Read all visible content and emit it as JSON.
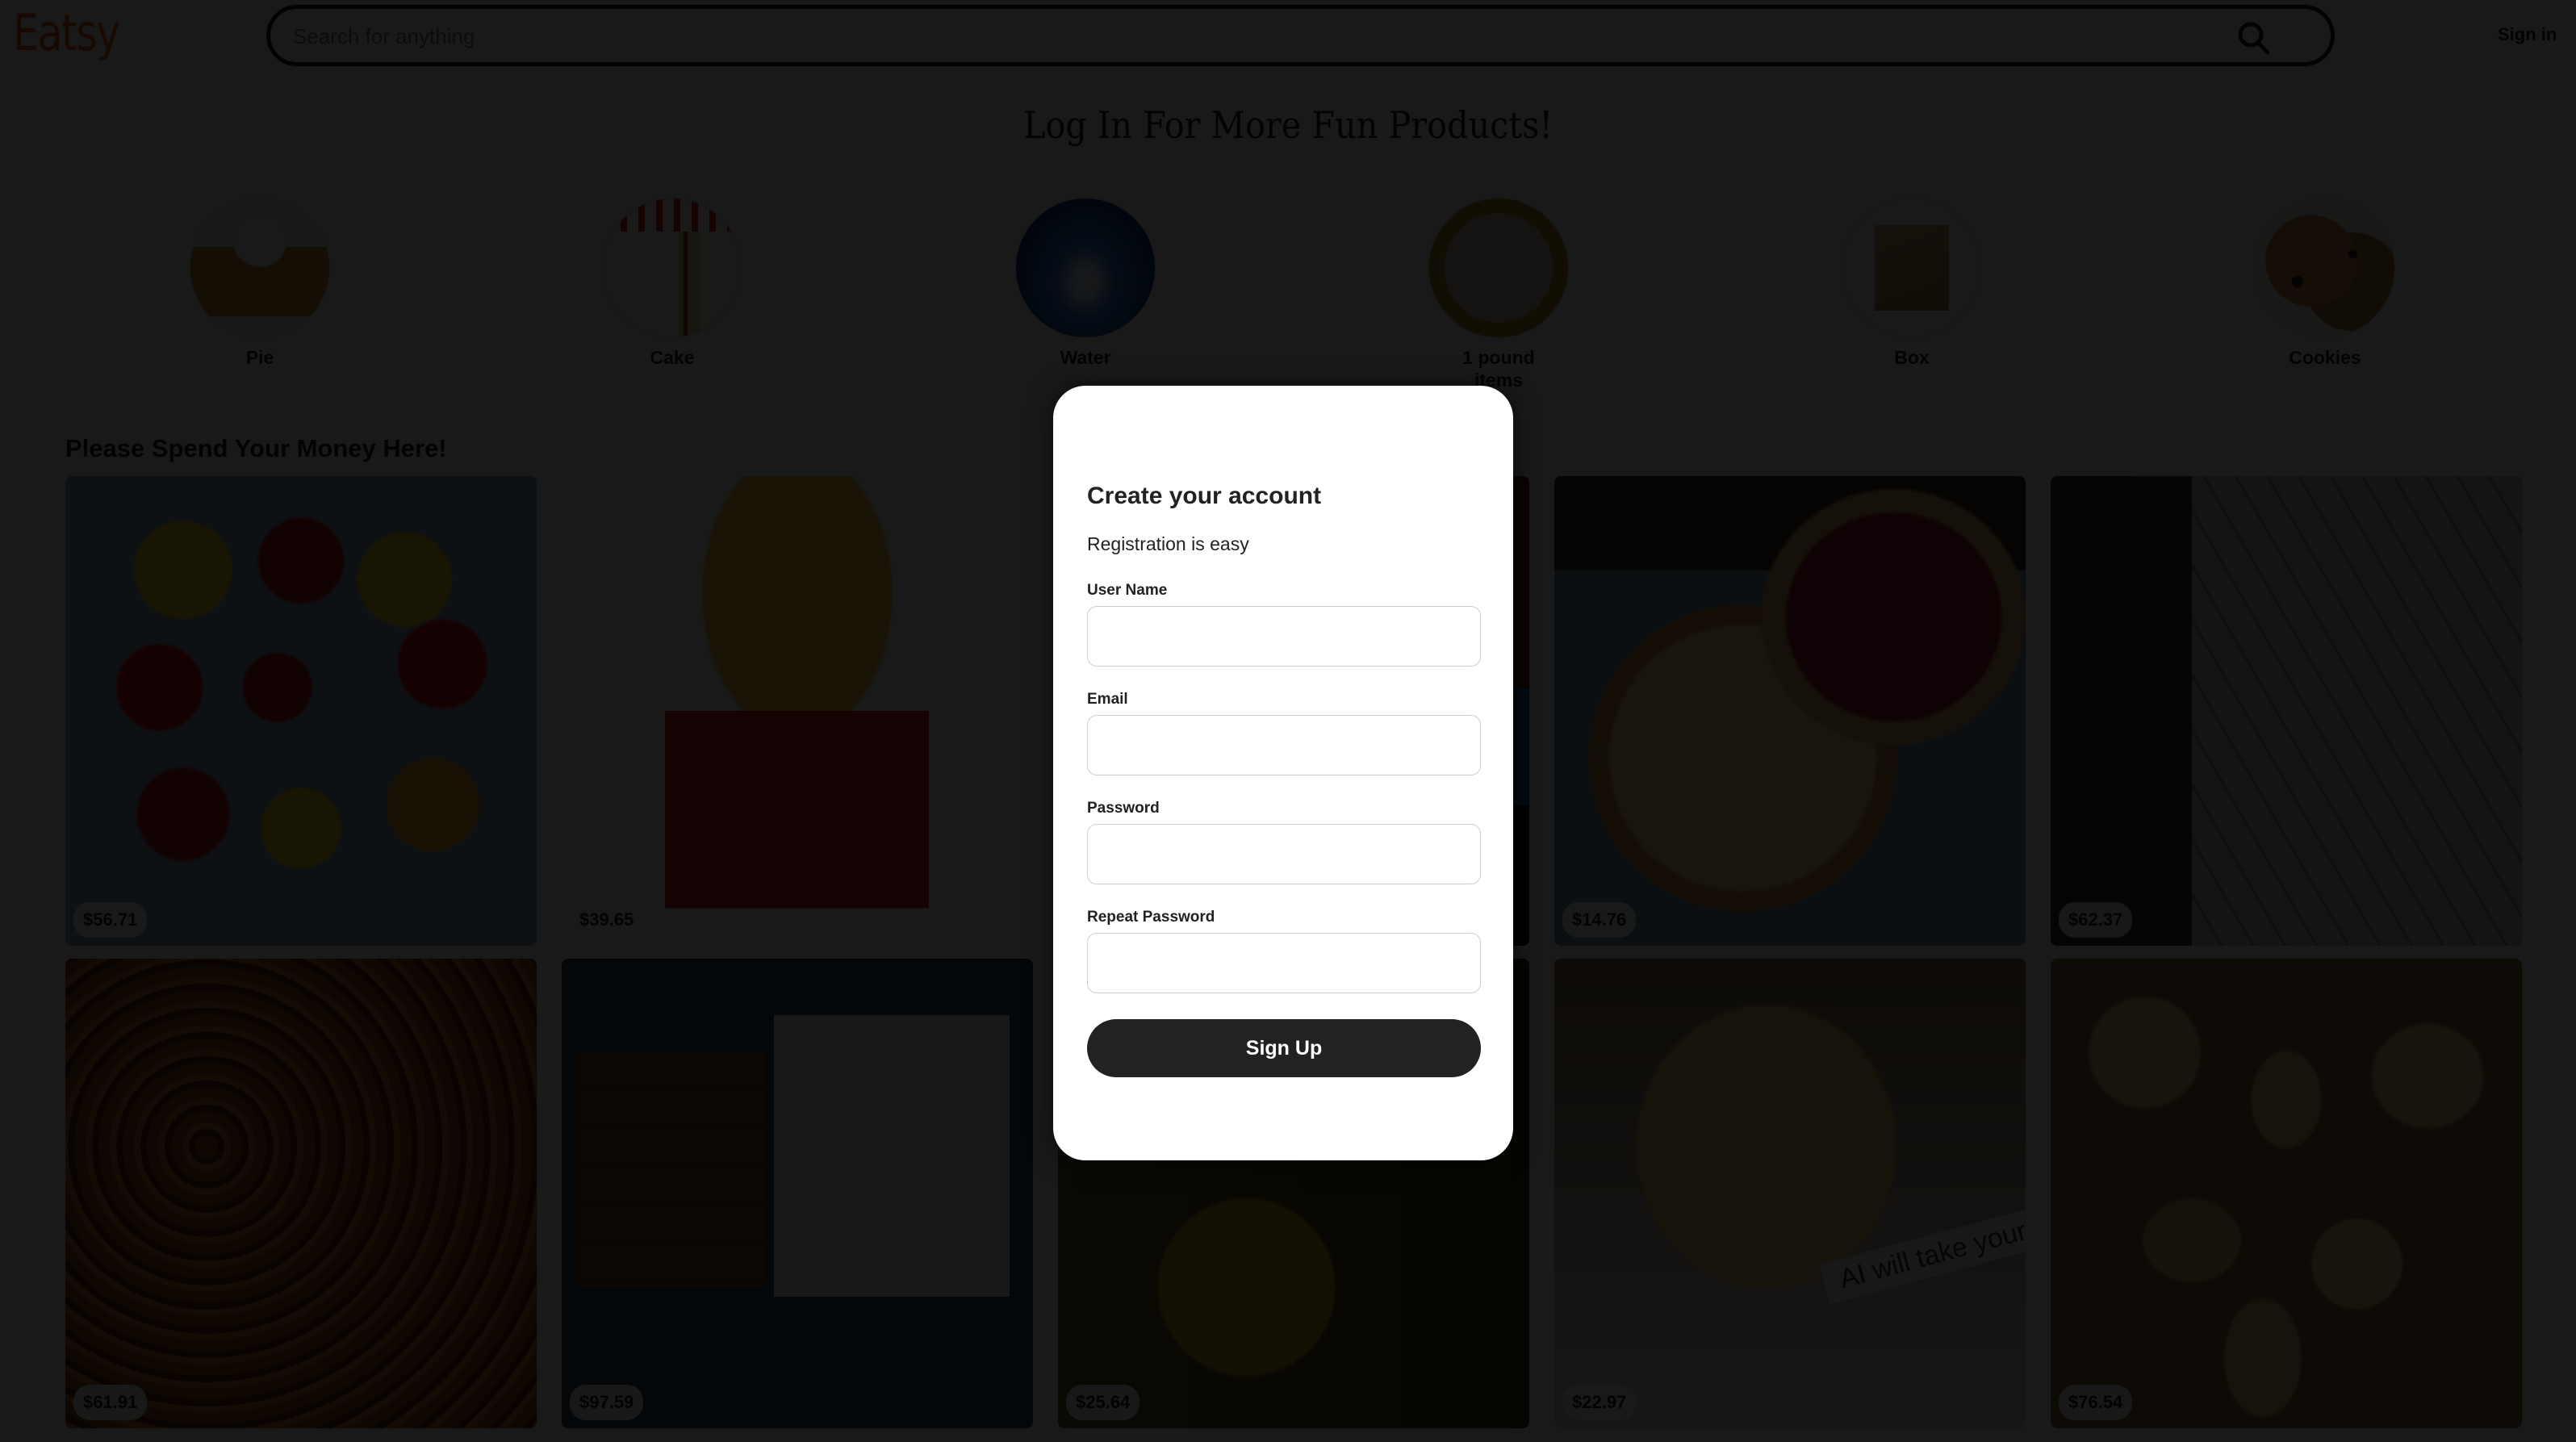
{
  "header": {
    "logo": "Eatsy",
    "search": {
      "placeholder": "Search for anything",
      "value": "",
      "icon": "search-icon"
    },
    "signin_label": "Sign in"
  },
  "page_title": "Log In For More Fun Products!",
  "categories": [
    {
      "label": "Pie",
      "image": "pie-with-cream"
    },
    {
      "label": "Cake",
      "image": "strawberry-layer-cake"
    },
    {
      "label": "Water",
      "image": "water-droplet-splash"
    },
    {
      "label": "1 pound items",
      "image": "one-pound-coin"
    },
    {
      "label": "Box",
      "image": "cardboard-box"
    },
    {
      "label": "Cookies",
      "image": "chocolate-chip-cookies"
    }
  ],
  "section_heading": "Please Spend Your Money Here!",
  "products": [
    {
      "price": "$56.71",
      "image": "gummy-bears"
    },
    {
      "price": "$39.65",
      "image": "dog-chips-bag"
    },
    {
      "price": "",
      "image": "hidden-behind-modal"
    },
    {
      "price": "$14.76",
      "image": "pies"
    },
    {
      "price": "$62.37",
      "image": "cash-dollars"
    },
    {
      "price": "$61.91",
      "image": "pretzels-chocolate"
    },
    {
      "price": "$97.59",
      "image": "cookies-and-milk"
    },
    {
      "price": "$25.64",
      "image": "jar-pickles"
    },
    {
      "price": "$22.97",
      "image": "fortune-cookie",
      "caption": "AI will take your j"
    },
    {
      "price": "$76.54",
      "image": "potatoes"
    }
  ],
  "modal": {
    "title": "Create your account",
    "subtitle": "Registration is easy",
    "fields": [
      {
        "label": "User Name",
        "value": "",
        "type": "text"
      },
      {
        "label": "Email",
        "value": "",
        "type": "email"
      },
      {
        "label": "Password",
        "value": "",
        "type": "password"
      },
      {
        "label": "Repeat Password",
        "value": "",
        "type": "password"
      }
    ],
    "submit_label": "Sign Up"
  },
  "colors": {
    "brand": "#f1641e",
    "overlay": "#000000e6",
    "button": "#222222",
    "text": "#222222"
  }
}
